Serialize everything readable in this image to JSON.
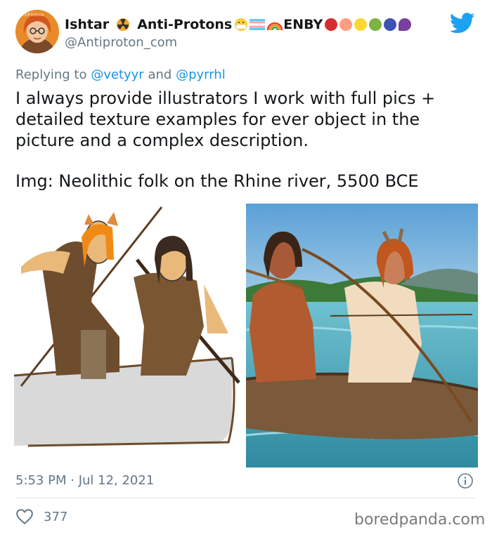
{
  "author": {
    "display_name": "Ishtar",
    "name_suffix": "Anti-Protons",
    "tag": "ENBY",
    "handle": "@Antiproton_com",
    "avatar_badge": "AntiProtons"
  },
  "reply": {
    "prefix": "Replying to",
    "mention_1": "@vetyyr",
    "joiner": "and",
    "mention_2": "@pyrrhl"
  },
  "text": {
    "line_1": "I always provide illustrators I work with full pics +",
    "line_2": "detailed texture examples for ever object in the",
    "line_3": "picture and a complex description.",
    "line_4": "Img: Neolithic folk on the Rhine river, 5500 BCE"
  },
  "media": {
    "left_description_icon": "crude-sketch-image",
    "right_description_icon": "detailed-illustration-image"
  },
  "meta": {
    "timestamp": "5:53 PM · Jul 12, 2021",
    "like_count": "377"
  },
  "watermark": "boredpanda.com",
  "colors": {
    "twitter_blue": "#1da1f2",
    "mention_blue": "#1b95e0",
    "secondary_text": "#657786",
    "divider": "#e1e8ed"
  },
  "icons": {
    "radioactive": "radioactive-icon",
    "mask": "mask-emoji-icon",
    "trans_flag": "trans-flag-icon",
    "rainbow": "rainbow-icon",
    "fruits": [
      "apple-icon",
      "peach-icon",
      "lemon-icon",
      "green-apple-icon",
      "blueberries-icon",
      "eggplant-icon"
    ],
    "twitter": "twitter-bird-icon",
    "info": "info-icon",
    "heart": "heart-icon"
  }
}
